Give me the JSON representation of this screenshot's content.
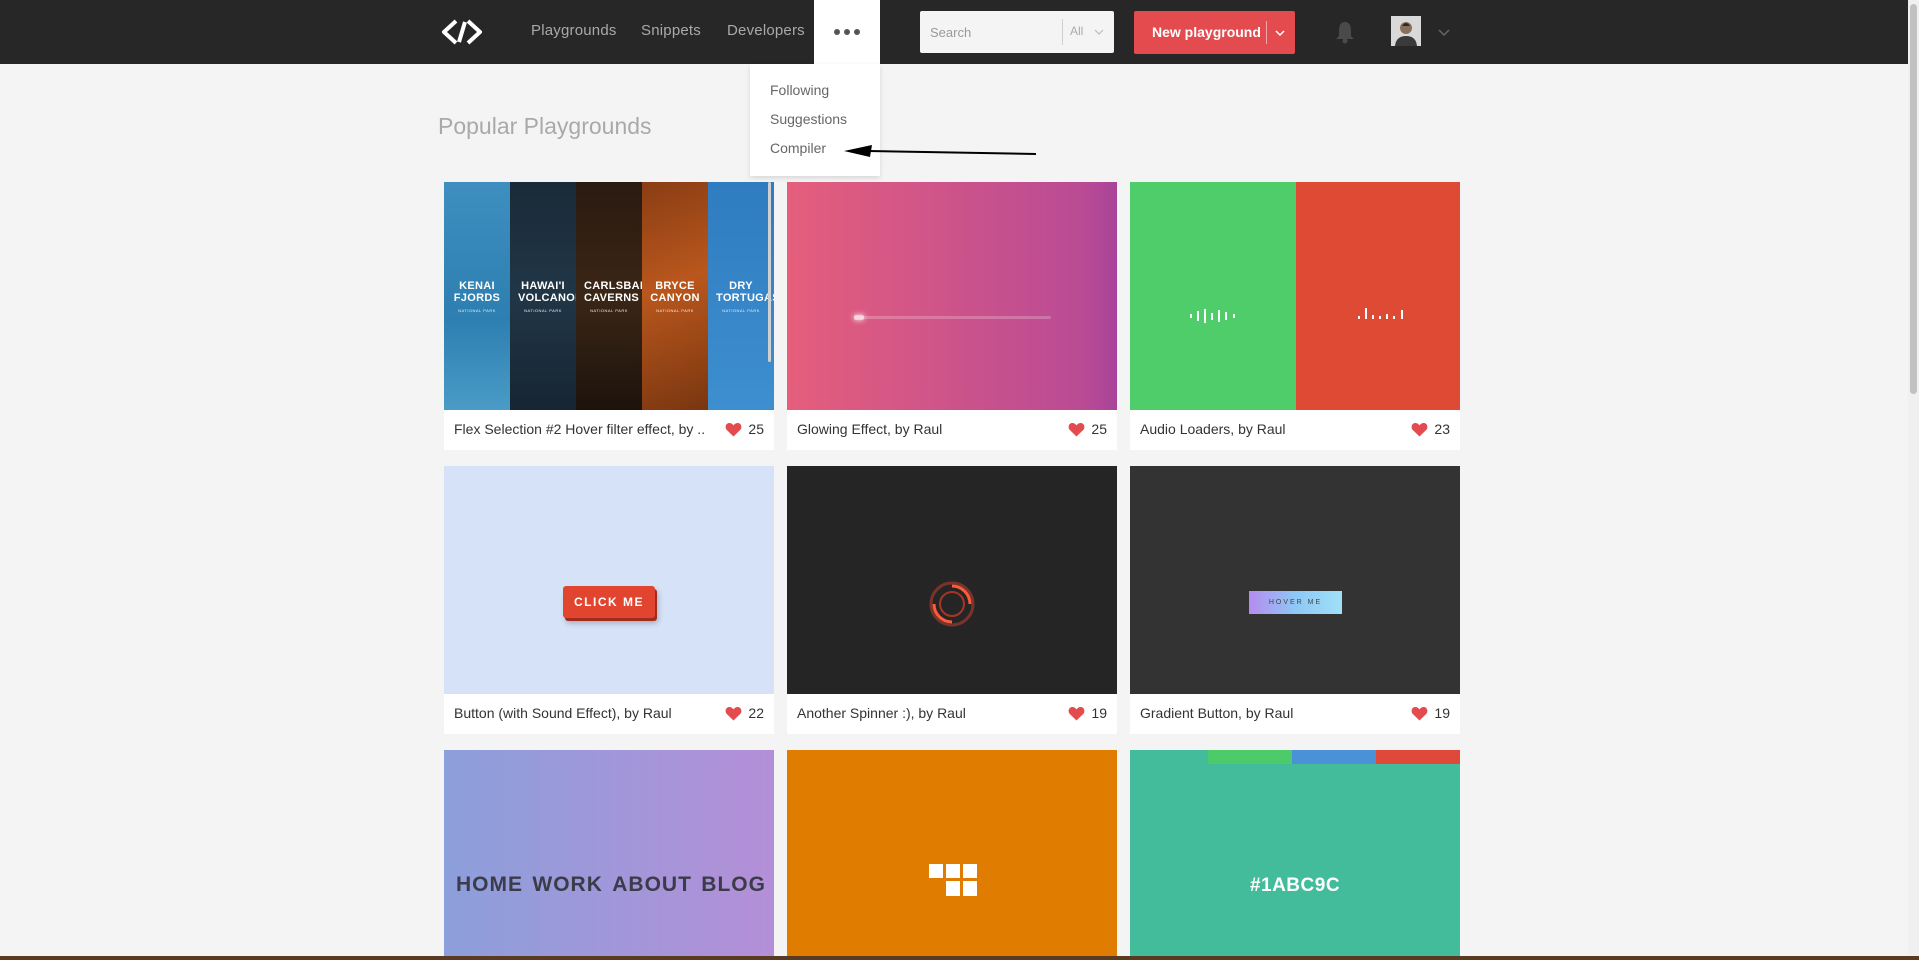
{
  "nav": {
    "links": [
      "Playgrounds",
      "Snippets",
      "Developers"
    ],
    "more_icon": "ellipsis-icon"
  },
  "search": {
    "placeholder": "Search",
    "filter": "All"
  },
  "new_button": {
    "label": "New playground"
  },
  "dropdown": {
    "items": [
      "Following",
      "Suggestions",
      "Compiler"
    ]
  },
  "page": {
    "title": "Popular Playgrounds"
  },
  "cards": [
    {
      "caption": "Flex Selection #2 Hover filter effect, by ...",
      "likes": "25",
      "panels": [
        {
          "title": "KENAI FJORDS",
          "sub": "NATIONAL PARK"
        },
        {
          "title": "HAWAI'I VOLCANOES",
          "sub": "NATIONAL PARK"
        },
        {
          "title": "CARLSBAD CAVERNS",
          "sub": "NATIONAL PARK"
        },
        {
          "title": "BRYCE CANYON",
          "sub": "NATIONAL PARK"
        },
        {
          "title": "DRY TORTUGAS",
          "sub": "NATIONAL PARK"
        }
      ]
    },
    {
      "caption": "Glowing Effect, by Raul",
      "likes": "25"
    },
    {
      "caption": "Audio Loaders, by Raul",
      "likes": "23"
    },
    {
      "caption": "Button (with Sound Effect), by Raul",
      "likes": "22",
      "button_text": "CLICK ME"
    },
    {
      "caption": "Another Spinner :), by Raul",
      "likes": "19"
    },
    {
      "caption": "Gradient Button, by Raul",
      "likes": "19",
      "button_text": "HOVER ME"
    },
    {
      "menu": [
        "HOME",
        "WORK",
        "ABOUT",
        "BLOG"
      ]
    },
    {},
    {
      "hex": "#1ABC9C"
    }
  ],
  "colors": {
    "topbar": "#272727",
    "accent": "#e34b4f",
    "heart": "#e34b4f"
  }
}
